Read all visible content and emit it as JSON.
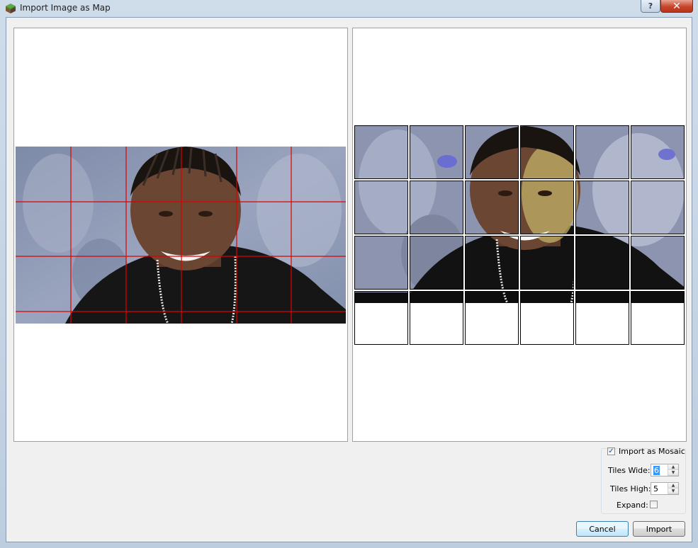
{
  "window": {
    "title": "Import Image as Map",
    "help_label": "?",
    "close_label": "✕"
  },
  "options": {
    "import_as_mosaic_label": "Import as Mosaic",
    "import_as_mosaic_checked": true,
    "tiles_wide_label": "Tiles Wide:",
    "tiles_wide_value": "6",
    "tiles_high_label": "Tiles High:",
    "tiles_high_value": "5",
    "expand_label": "Expand:",
    "expand_checked": false
  },
  "buttons": {
    "cancel_label": "Cancel",
    "import_label": "Import"
  },
  "colors": {
    "grid_line": "#e00000",
    "accent": "#3c7fb1"
  }
}
